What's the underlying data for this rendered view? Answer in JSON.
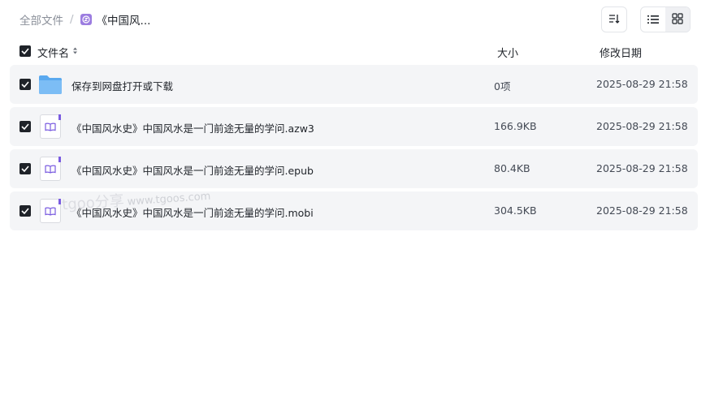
{
  "breadcrumb": {
    "root": "全部文件",
    "separator": "/",
    "current": "《中国风..."
  },
  "toolbar": {
    "sort_icon": "sort-descending-icon",
    "list_view_icon": "list-view-icon",
    "grid_view_icon": "grid-view-icon"
  },
  "columns": {
    "name": "文件名",
    "size": "大小",
    "date": "修改日期"
  },
  "files": [
    {
      "name": "保存到网盘打开或下载",
      "size": "0项",
      "date": "2025-08-29 21:58",
      "type": "folder"
    },
    {
      "name": "《中国风水史》中国风水是一门前途无量的学问.azw3",
      "size": "166.9KB",
      "date": "2025-08-29 21:58",
      "type": "ebook"
    },
    {
      "name": "《中国风水史》中国风水是一门前途无量的学问.epub",
      "size": "80.4KB",
      "date": "2025-08-29 21:58",
      "type": "ebook"
    },
    {
      "name": "《中国风水史》中国风水是一门前途无量的学问.mobi",
      "size": "304.5KB",
      "date": "2025-08-29 21:58",
      "type": "ebook"
    }
  ],
  "watermark": {
    "brand": "tgoo",
    "cn": "分享",
    "url": "www.tgoos.com"
  },
  "colors": {
    "accent": "#7a5ce0",
    "row_bg": "#f4f5f7",
    "checkbox": "#1f2329",
    "folder": "#5aa9ef"
  }
}
